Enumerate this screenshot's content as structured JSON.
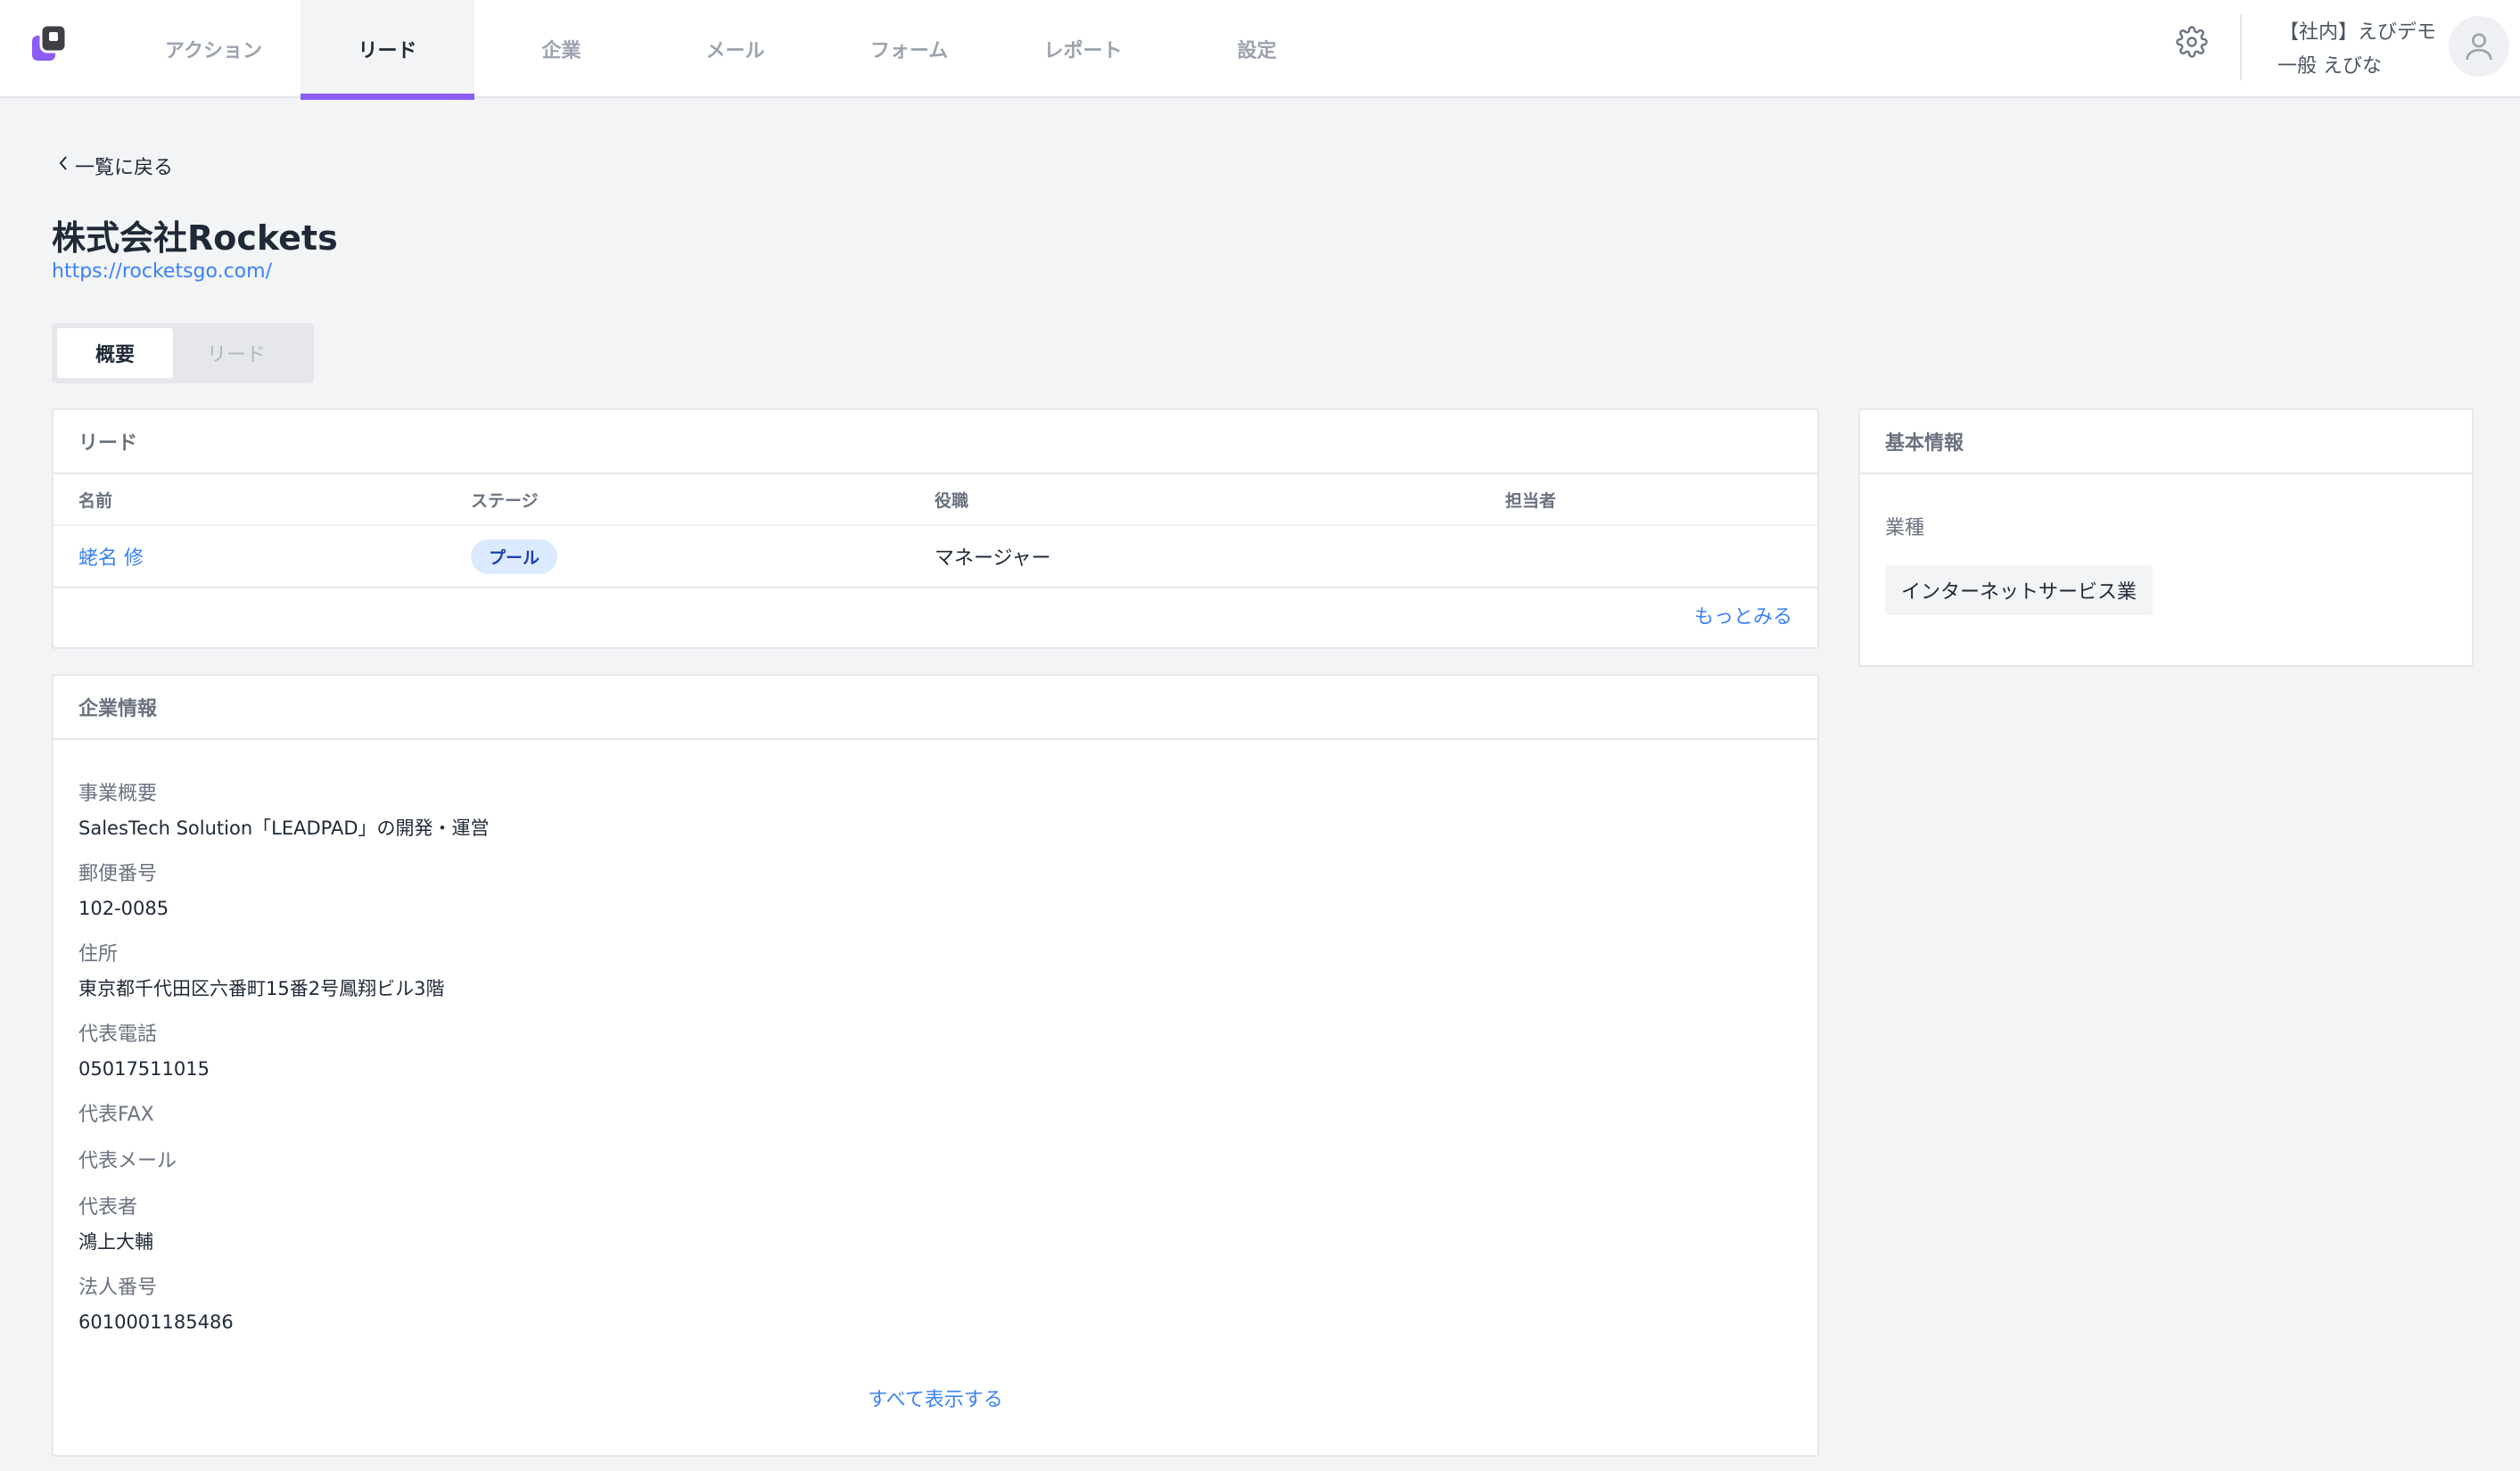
{
  "nav": {
    "items": [
      {
        "label": "アクション",
        "active": false
      },
      {
        "label": "リード",
        "active": true
      },
      {
        "label": "企業",
        "active": false
      },
      {
        "label": "メール",
        "active": false
      },
      {
        "label": "フォーム",
        "active": false
      },
      {
        "label": "レポート",
        "active": false
      },
      {
        "label": "設定",
        "active": false
      }
    ]
  },
  "user": {
    "org": "【社内】えびデモ",
    "name": "一般 えびな"
  },
  "header": {
    "back_label": "一覧に戻る",
    "company_name": "株式会社Rockets",
    "company_url": "https://rocketsgo.com/"
  },
  "tabs": [
    {
      "label": "概要",
      "active": true
    },
    {
      "label": "リード",
      "active": false
    }
  ],
  "leads_card": {
    "title": "リード",
    "columns": [
      "名前",
      "ステージ",
      "役職",
      "担当者"
    ],
    "rows": [
      {
        "name": "蛯名 修",
        "stage": "プール",
        "role": "マネージャー",
        "owner": ""
      }
    ],
    "more_label": "もっとみる"
  },
  "company_info": {
    "title": "企業情報",
    "fields": [
      {
        "label": "事業概要",
        "value": "SalesTech Solution「LEADPAD」の開発・運営"
      },
      {
        "label": "郵便番号",
        "value": "102-0085"
      },
      {
        "label": "住所",
        "value": "東京都千代田区六番町15番2号鳳翔ビル3階"
      },
      {
        "label": "代表電話",
        "value": "05017511015"
      },
      {
        "label": "代表FAX",
        "value": ""
      },
      {
        "label": "代表メール",
        "value": ""
      },
      {
        "label": "代表者",
        "value": "鴻上大輔"
      },
      {
        "label": "法人番号",
        "value": "6010001185486"
      }
    ],
    "show_all_label": "すべて表示する"
  },
  "basic_info": {
    "title": "基本情報",
    "industry_label": "業種",
    "industry_value": "インターネットサービス業"
  },
  "colors": {
    "accent": "#8b5cf6",
    "link": "#3b82f6",
    "badge_bg": "#dbeafe",
    "page_bg": "#f3f4f6"
  }
}
